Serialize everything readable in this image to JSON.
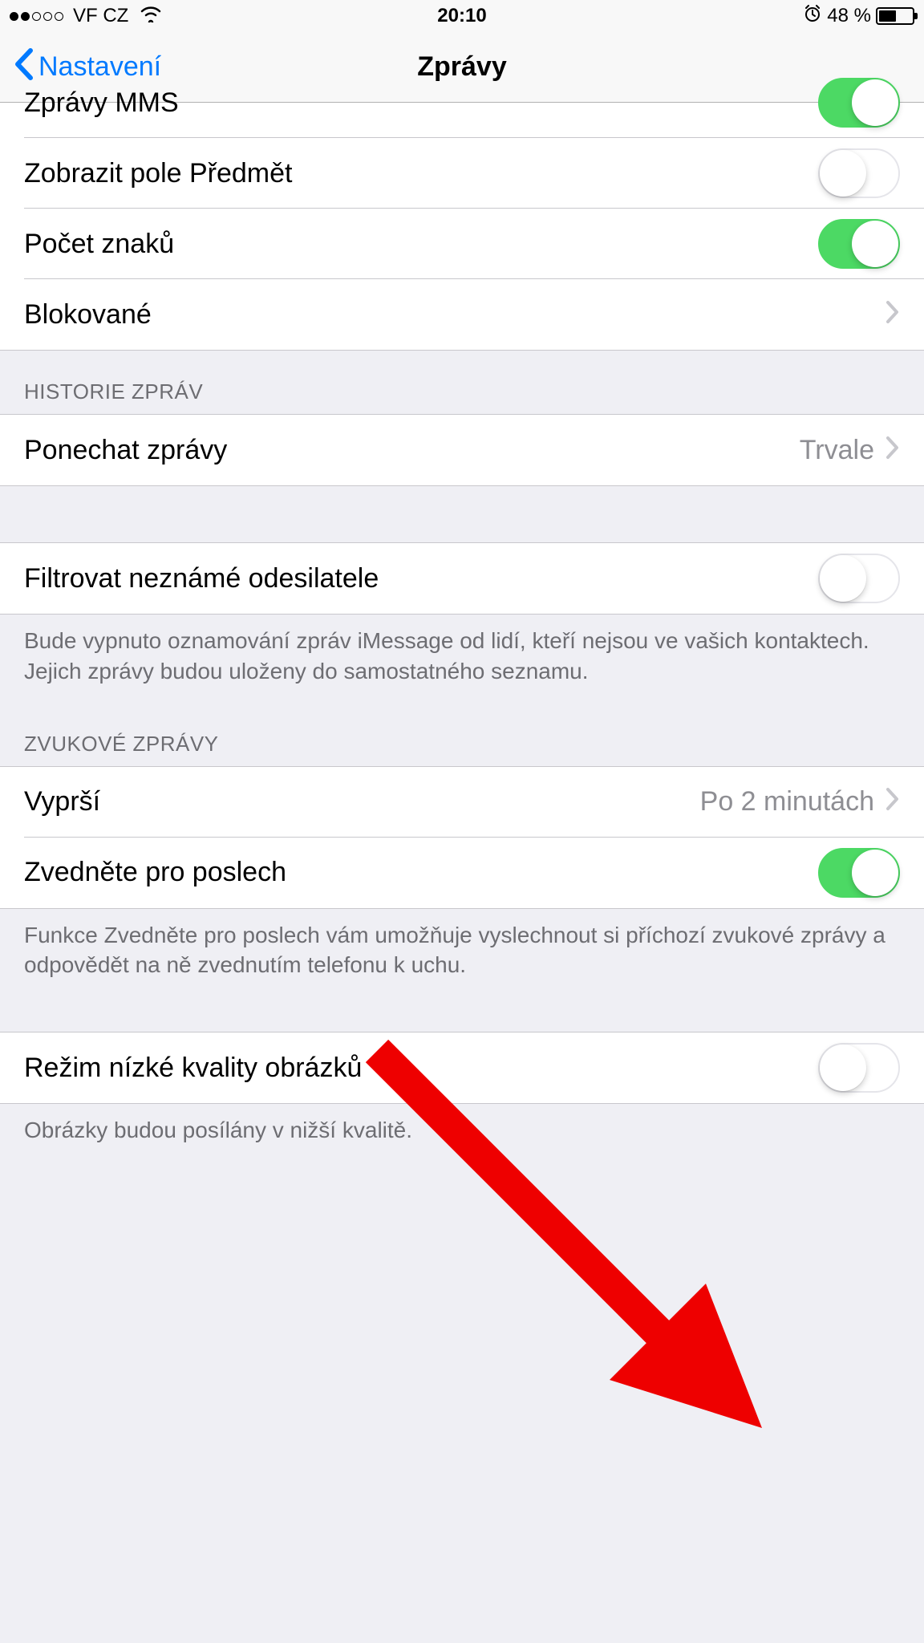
{
  "status_bar": {
    "carrier": "VF CZ",
    "time": "20:10",
    "battery_text": "48 %"
  },
  "nav": {
    "back_label": "Nastavení",
    "title": "Zprávy"
  },
  "section1": {
    "rows": [
      {
        "label": "Zprávy MMS",
        "toggle": true
      },
      {
        "label": "Zobrazit pole Předmět",
        "toggle": false
      },
      {
        "label": "Počet znaků",
        "toggle": true
      },
      {
        "label": "Blokované"
      }
    ]
  },
  "section_history": {
    "header": "HISTORIE ZPRÁV",
    "row": {
      "label": "Ponechat zprávy",
      "value": "Trvale"
    }
  },
  "section_filter": {
    "row": {
      "label": "Filtrovat neznámé odesilatele",
      "toggle": false
    },
    "footer": "Bude vypnuto oznamování zpráv iMessage od lidí, kteří nejsou ve vašich kontaktech. Jejich zprávy budou uloženy do samostatného seznamu."
  },
  "section_audio": {
    "header": "ZVUKOVÉ ZPRÁVY",
    "rows": [
      {
        "label": "Vyprší",
        "value": "Po 2 minutách"
      },
      {
        "label": "Zvedněte pro poslech",
        "toggle": true
      }
    ],
    "footer": "Funkce Zvedněte pro poslech vám umožňuje vyslechnout si příchozí zvukové zprávy a odpovědět na ně zvednutím telefonu k uchu."
  },
  "section_lowq": {
    "row": {
      "label": "Režim nízké kvality obrázků",
      "toggle": false
    },
    "footer": "Obrázky budou posílány v nižší kvalitě."
  }
}
